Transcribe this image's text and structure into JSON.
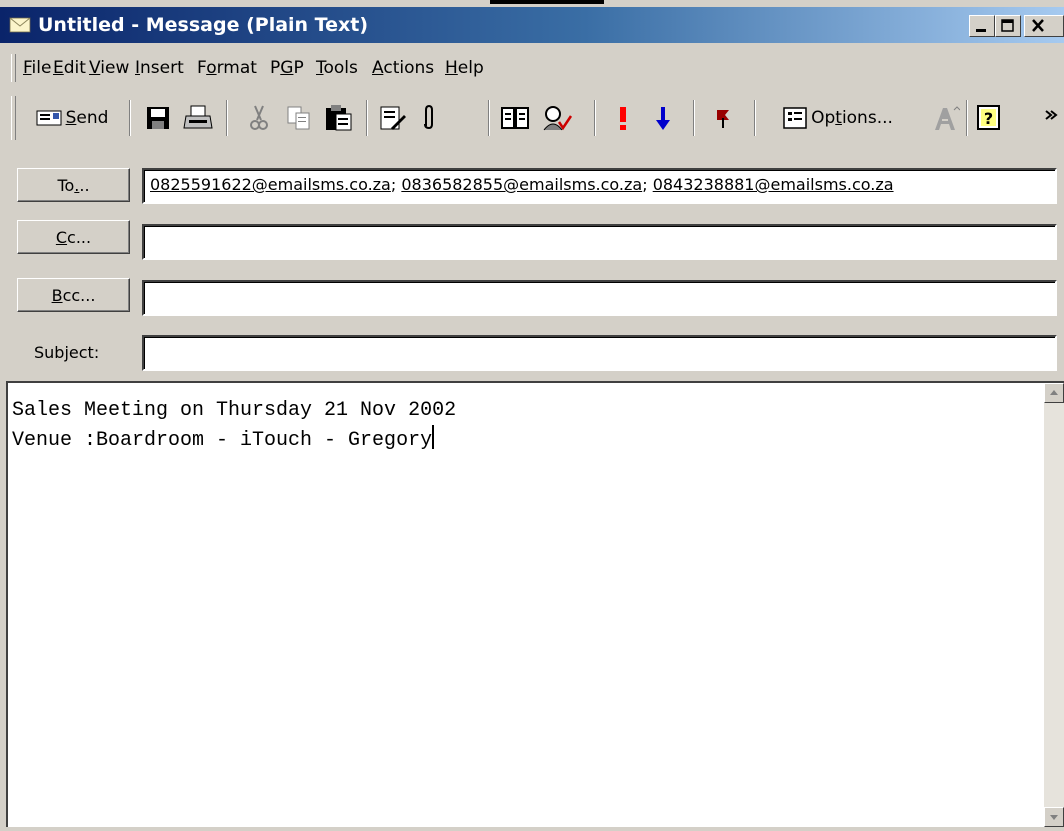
{
  "window": {
    "title": "Untitled - Message (Plain Text)",
    "icon": "envelope-icon",
    "controls": [
      "minimize-icon",
      "maximize-icon",
      "close-icon"
    ]
  },
  "menu": {
    "items": [
      {
        "label": "File",
        "underline": "F",
        "rest": "ile"
      },
      {
        "label": "Edit",
        "underline": "",
        "rest": "Edit"
      },
      {
        "label": "View",
        "underline": "V",
        "rest": "iew"
      },
      {
        "label": "Insert",
        "underline": "I",
        "rest": "nsert"
      },
      {
        "label": "Format",
        "pre": "F",
        "underline": "o",
        "rest": "rmat"
      },
      {
        "label": "PGP",
        "pre": "P",
        "underline": "G",
        "rest": "P"
      },
      {
        "label": "Tools",
        "underline": "T",
        "rest": "ools"
      },
      {
        "label": "Actions",
        "underline": "A",
        "rest": "ctions"
      },
      {
        "label": "Help",
        "underline": "H",
        "rest": "elp"
      }
    ]
  },
  "toolbar": {
    "send_label": "Send",
    "send_underline": "S",
    "send_rest": "end",
    "options_label": "Options...",
    "options_pre": "Op",
    "options_underline": "t",
    "options_rest": "ions...",
    "icons": [
      "send-icon",
      "save-icon",
      "print-icon",
      "cut-icon",
      "copy-icon",
      "paste-icon",
      "insert-file-icon",
      "attachment-icon",
      "address-book-icon",
      "check-names-icon",
      "importance-high-icon",
      "importance-low-icon",
      "flag-icon",
      "options-icon",
      "font-icon",
      "help-icon",
      "more-icon"
    ]
  },
  "header": {
    "to_button": {
      "pre": "To",
      "underline": ".",
      "rest": ".."
    },
    "cc_button": {
      "underline": "C",
      "rest": "c..."
    },
    "bcc_button": {
      "underline": "B",
      "rest": "cc..."
    },
    "subject_label": "Subject:",
    "to_value": [
      "0825591622@emailsms.co.za",
      "0836582855@emailsms.co.za",
      "0843238881@emailsms.co.za"
    ],
    "cc_value": "",
    "bcc_value": "",
    "subject_value": ""
  },
  "body": {
    "line1": "Sales Meeting on Thursday 21 Nov 2002",
    "line2": "Venue :Boardroom - iTouch - Gregory"
  },
  "colors": {
    "title_start": "#0a246a",
    "title_end": "#a6caf0",
    "chrome": "#d4d0c8",
    "importance_high": "#ff0000",
    "importance_low": "#0000cc",
    "flag": "#990000"
  }
}
